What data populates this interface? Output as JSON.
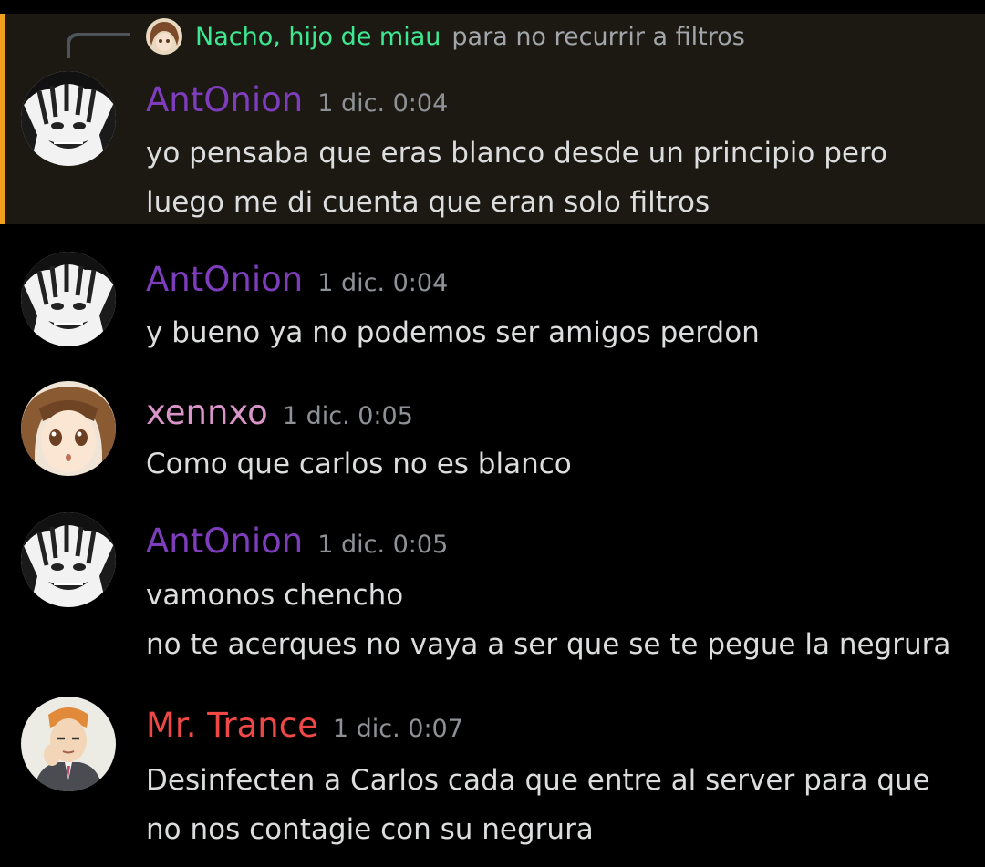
{
  "colors": {
    "background": "#000000",
    "highlight_background": "#1c1913",
    "highlight_bar": "#f0a21e",
    "reply_author": "#3ce891",
    "antonion": "#7e3dbd",
    "xennxo": "#d995c8",
    "mr_trance": "#f04747",
    "timestamp": "#8e9297",
    "message_text": "#dcddde"
  },
  "reply": {
    "author": "Nacho, hijo de miau",
    "text": "para no recurrir a filtros"
  },
  "messages": [
    {
      "author": "AntOnion",
      "time": "1 dic. 0:04",
      "avatar": "antonion-avatar",
      "lines": [
        "yo pensaba que eras blanco desde un principio pero",
        "luego me di cuenta que eran solo filtros"
      ]
    },
    {
      "author": "AntOnion",
      "time": "1 dic. 0:04",
      "avatar": "antonion-avatar",
      "lines": [
        "y bueno ya no podemos ser amigos perdon"
      ]
    },
    {
      "author": "xennxo",
      "time": "1 dic. 0:05",
      "avatar": "xennxo-avatar",
      "lines": [
        "Como que carlos no es blanco"
      ]
    },
    {
      "author": "AntOnion",
      "time": "1 dic. 0:05",
      "avatar": "antonion-avatar",
      "lines": [
        "vamonos chencho",
        "no te acerques no vaya a ser que se te pegue la negrura"
      ]
    },
    {
      "author": "Mr. Trance",
      "time": "1 dic. 0:07",
      "avatar": "mr-trance-avatar",
      "lines": [
        "Desinfecten a Carlos cada que entre al server para que",
        "no nos contagie con su negrura"
      ]
    }
  ]
}
